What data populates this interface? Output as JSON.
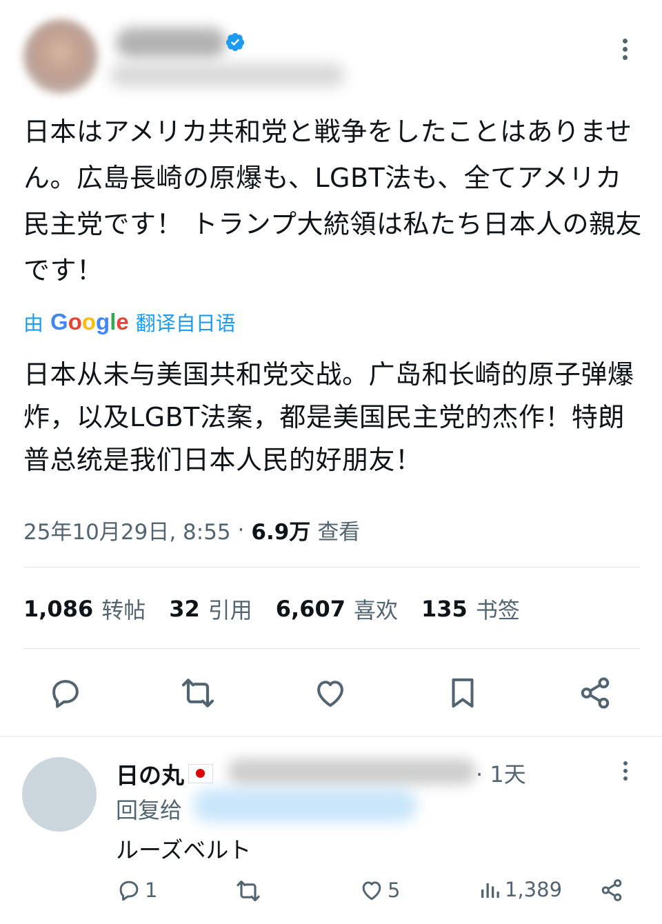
{
  "tweet": {
    "text": "日本はアメリカ共和党と戦争をしたことはありません。広島長崎の原爆も、LGBT法も、全てアメリカ民主党です！ トランプ大統領は私たち日本人の親友です！",
    "translated_by_prefix": "由",
    "translated_by_brand": "Google",
    "translated_by_suffix": "翻译自日语",
    "translation": "日本从未与美国共和党交战。广岛和长崎的原子弹爆炸，以及LGBT法案，都是美国民主党的杰作！特朗普总统是我们日本人民的好朋友！",
    "timestamp": "25年10月29日, 8:55",
    "views_count": "6.9万",
    "views_label": "查看"
  },
  "stats": {
    "reposts_count": "1,086",
    "reposts_label": "转帖",
    "quotes_count": "32",
    "quotes_label": "引用",
    "likes_count": "6,607",
    "likes_label": "喜欢",
    "bookmarks_count": "135",
    "bookmarks_label": "书签"
  },
  "reply": {
    "name": "日の丸",
    "time": "· 1天",
    "reply_to_label": "回复给",
    "text": "ルーズベルト",
    "replies_count": "1",
    "likes_count": "5",
    "views_count": "1,389"
  },
  "colors": {
    "text_primary": "#0f1419",
    "text_secondary": "#536471",
    "accent": "#1d9bf0",
    "divider": "#e3e6e9"
  }
}
